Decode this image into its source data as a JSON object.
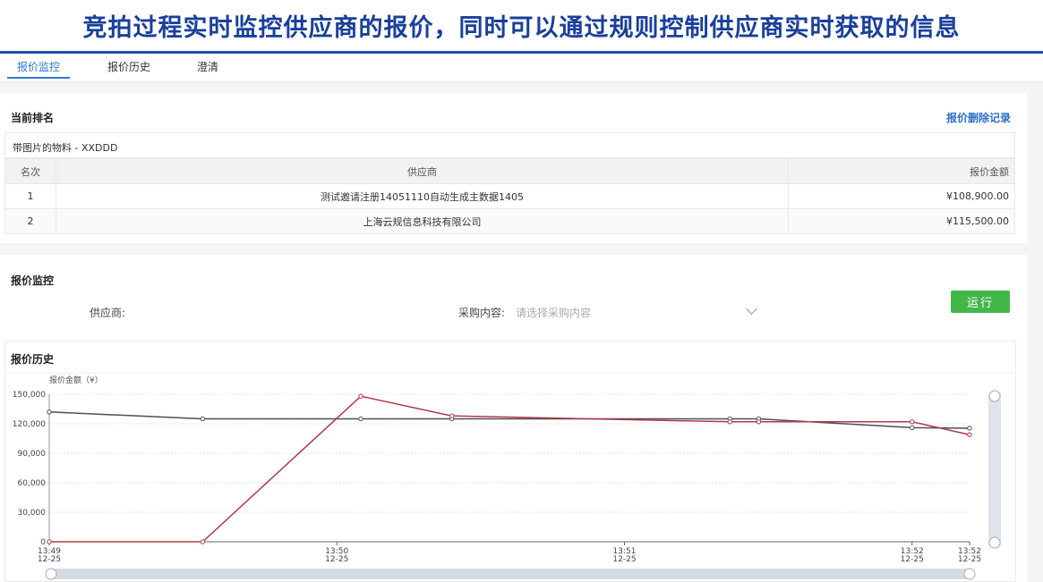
{
  "banner": {
    "title": "竞拍过程实时监控供应商的报价，同时可以通过规则控制供应商实时获取的信息"
  },
  "tabs": [
    {
      "label": "报价监控",
      "active": true
    },
    {
      "label": "报价历史",
      "active": false
    },
    {
      "label": "澄清",
      "active": false
    }
  ],
  "ranking": {
    "title": "当前排名",
    "delete_link": "报价删除记录",
    "material": "带图片的物料 - XXDDD",
    "columns": [
      "名次",
      "供应商",
      "报价金额"
    ],
    "rows": [
      {
        "rank": "1",
        "supplier": "测试邀请注册14051110自动生成主数据1405",
        "amount": "¥108,900.00"
      },
      {
        "rank": "2",
        "supplier": "上海云规信息科技有限公司",
        "amount": "¥115,500.00"
      }
    ]
  },
  "monitor": {
    "title": "报价监控",
    "supplier_label": "供应商:",
    "content_label": "采购内容:",
    "content_placeholder": "请选择采购内容",
    "run_label": "运行"
  },
  "history": {
    "title": "报价历史"
  },
  "chart_data": {
    "type": "line",
    "ylabel": "报价金额（¥）",
    "ylim": [
      0,
      150000
    ],
    "yticks": [
      "150,000",
      "120,000",
      "90,000",
      "60,000",
      "30,000",
      "0"
    ],
    "xticks": [
      {
        "time": "13:49",
        "date": "12-25",
        "t": 0
      },
      {
        "time": "13:50",
        "date": "12-25",
        "t": 60
      },
      {
        "time": "13:51",
        "date": "12-25",
        "t": 120
      },
      {
        "time": "13:52",
        "date": "12-25",
        "t": 180
      },
      {
        "time": "13:52",
        "date": "12-25",
        "t": 192
      }
    ],
    "grid": true,
    "colors": {
      "series1": "#4a5055",
      "series2": "#b03a48"
    },
    "series": [
      {
        "points": [
          [
            0,
            132000
          ],
          [
            32,
            125000
          ],
          [
            65,
            125000
          ],
          [
            84,
            125000
          ],
          [
            142,
            125000
          ],
          [
            148,
            125000
          ],
          [
            180,
            116000
          ],
          [
            192,
            115500
          ]
        ]
      },
      {
        "points": [
          [
            0,
            0
          ],
          [
            32,
            0
          ],
          [
            65,
            148000
          ],
          [
            84,
            128000
          ],
          [
            142,
            122000
          ],
          [
            148,
            122000
          ],
          [
            180,
            122000
          ],
          [
            192,
            108900
          ]
        ]
      }
    ]
  }
}
